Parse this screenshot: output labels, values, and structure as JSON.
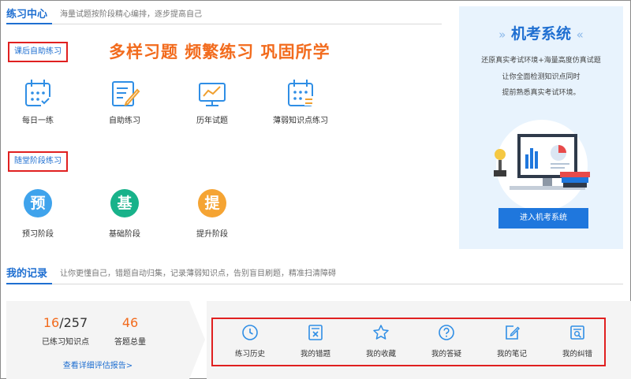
{
  "practice_center": {
    "title": "练习中心",
    "subtitle": "海量试题按阶段精心编排，逐步提高自己"
  },
  "self_practice": {
    "category_label": "课后自助练习",
    "slogan": "多样习题  频繁练习  巩固所学",
    "tools": [
      {
        "label": "每日一练",
        "icon": "calendar-grid-icon"
      },
      {
        "label": "自助练习",
        "icon": "notebook-pen-icon"
      },
      {
        "label": "历年试题",
        "icon": "chart-board-icon"
      },
      {
        "label": "薄弱知识点练习",
        "icon": "calendar-list-icon"
      }
    ]
  },
  "stage_practice": {
    "category_label": "随堂阶段练习",
    "stages": [
      {
        "glyph": "预",
        "label": "预习阶段",
        "color": "#3fa3ec"
      },
      {
        "glyph": "基",
        "label": "基础阶段",
        "color": "#18b28a"
      },
      {
        "glyph": "提",
        "label": "提升阶段",
        "color": "#f5a433"
      }
    ]
  },
  "exam_system": {
    "title": "机考系统",
    "desc_lines": [
      "还原真实考试环境+海量高度仿真试题",
      "让你全面检测知识点同时",
      "提前熟悉真实考试环境。"
    ],
    "button_label": "进入机考系统"
  },
  "records": {
    "title": "我的记录",
    "subtitle": "让你更懂自己，错题自动归集，记录薄弱知识点，告别盲目刷题，精准扫清障碍",
    "stats": {
      "practiced": "16",
      "total_points": "/257",
      "practiced_label": "已练习知识点",
      "answer_count": "46",
      "answer_label": "答题总量"
    },
    "report_link": "查看详细评估报告>",
    "items": [
      {
        "label": "练习历史",
        "icon": "clock-icon"
      },
      {
        "label": "我的错题",
        "icon": "wrong-doc-icon"
      },
      {
        "label": "我的收藏",
        "icon": "star-icon"
      },
      {
        "label": "我的答疑",
        "icon": "question-icon"
      },
      {
        "label": "我的笔记",
        "icon": "note-edit-icon"
      },
      {
        "label": "我的纠错",
        "icon": "search-doc-icon"
      }
    ]
  },
  "colors": {
    "primary": "#1f6fd1",
    "accent_orange": "#f26b1d",
    "highlight_red": "#e02020"
  }
}
